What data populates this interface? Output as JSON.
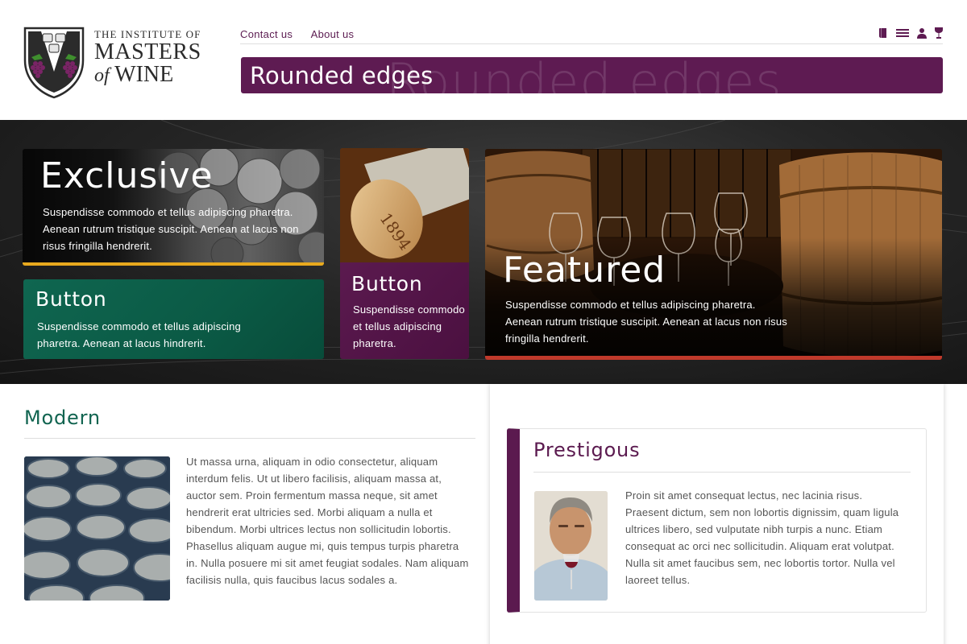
{
  "logo": {
    "line1": "THE INSTITUTE OF",
    "line2": "MASTERS",
    "line3_prefix": "of",
    "line3_word": "WINE"
  },
  "nav": {
    "links": [
      "Contact us",
      "About us"
    ],
    "icons": [
      "book-icon",
      "menu-icon",
      "user-icon",
      "wine-glass-icon"
    ]
  },
  "banner": {
    "text": "Rounded edges",
    "ghost_text": "Rounded edges"
  },
  "hero": {
    "exclusive": {
      "title": "Exclusive",
      "text": "Suspendisse commodo et tellus adipiscing pharetra. Aenean rutrum tristique suscipit. Aenean at lacus non risus fringilla hendrerit."
    },
    "green_button": {
      "title": "Button",
      "text": "Suspendisse commodo et tellus adipiscing pharetra. Aenean at lacus hindrerit."
    },
    "cork_image_text": "1894",
    "purple_button": {
      "title": "Button",
      "text": "Suspendisse commodo et tellus adipiscing pharetra."
    },
    "featured": {
      "title": "Featured",
      "text": "Suspendisse commodo et tellus adipiscing pharetra. Aenean rutrum tristique suscipit. Aenean at lacus non risus fringilla hendrerit."
    }
  },
  "modern": {
    "title": "Modern",
    "text": "Ut massa urna, aliquam in odio consectetur, aliquam interdum felis. Ut ut libero facilisis, aliquam massa at, auctor sem. Proin fermentum massa neque, sit amet hendrerit erat ultricies sed. Morbi aliquam a nulla et bibendum. Morbi ultrices lectus non sollicitudin lobortis. Phasellus aliquam augue mi, quis tempus turpis pharetra in. Nulla posuere mi sit amet feugiat sodales. Nam aliquam facilisis nulla, quis faucibus lacus sodales a."
  },
  "prestigious": {
    "title": "Prestigous",
    "text": "Proin sit amet consequat lectus, nec lacinia risus. Praesent dictum, sem non lobortis dignissim, quam ligula ultrices libero, sed vulputate nibh turpis a nunc. Etiam consequat ac orci nec sollicitudin. Aliquam erat volutpat. Nulla sit amet faucibus sem, nec lobortis tortor. Nulla vel laoreet tellus."
  },
  "colors": {
    "purple": "#5e1b52",
    "green": "#0f6650",
    "gold": "#e8a91e",
    "red": "#c0392b"
  }
}
